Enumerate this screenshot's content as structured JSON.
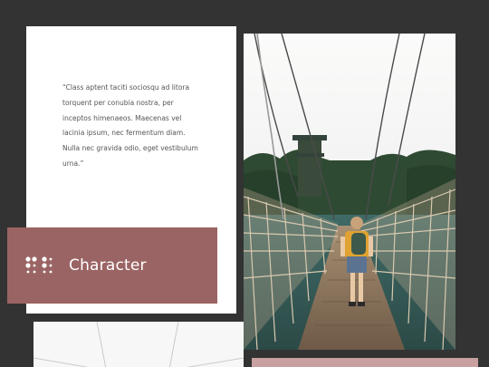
{
  "quote": {
    "text": "“Class aptent taciti sociosqu ad litora torquent per conubia nostra, per inceptos himenaeos. Maecenas vel lacinia ipsum, nec fermentum diam. Nulla nec gravida odio, eget vestibulum urna.”"
  },
  "label": {
    "text": "Character",
    "icon": "dots-grid-icon"
  },
  "photo": {
    "subject": "suspension-bridge-hiker-photo"
  },
  "colors": {
    "background": "#333333",
    "card": "#ffffff",
    "accent": "#9b6464",
    "accent_light": "#c9a0a0"
  }
}
